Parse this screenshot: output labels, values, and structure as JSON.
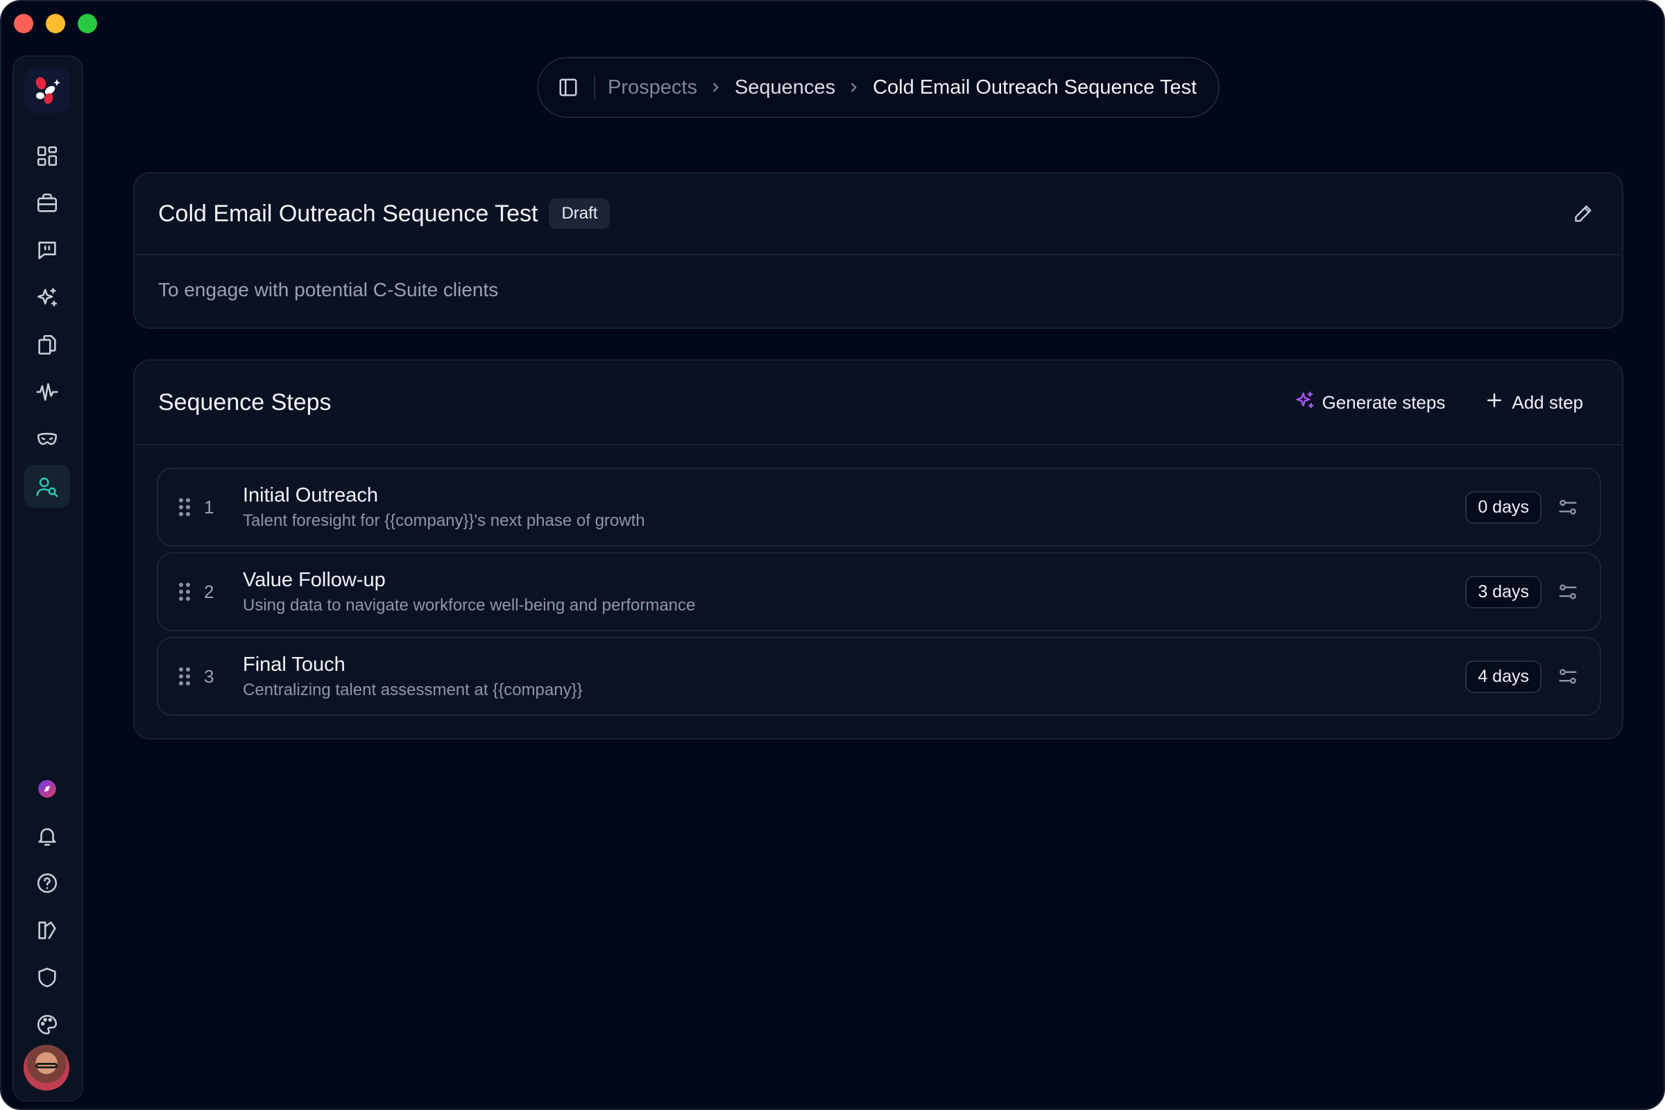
{
  "breadcrumb": {
    "items": [
      "Prospects",
      "Sequences"
    ],
    "current": "Cold Email Outreach Sequence Test"
  },
  "sequence": {
    "title": "Cold Email Outreach Sequence Test",
    "status": "Draft",
    "description": "To engage with potential C-Suite clients"
  },
  "steps_panel": {
    "title": "Sequence Steps",
    "generate_label": "Generate steps",
    "add_label": "Add step"
  },
  "steps": [
    {
      "number": "1",
      "name": "Initial Outreach",
      "subject": "Talent foresight for {{company}}'s next phase of growth",
      "delay": "0 days"
    },
    {
      "number": "2",
      "name": "Value Follow-up",
      "subject": "Using data to navigate workforce well-being and performance",
      "delay": "3 days"
    },
    {
      "number": "3",
      "name": "Final Touch",
      "subject": "Centralizing talent assessment at {{company}}",
      "delay": "4 days"
    }
  ],
  "sidebar": {
    "active": "prospects",
    "top_icons": [
      "dashboard-icon",
      "briefcase-icon",
      "chat-quote-icon",
      "sparkles-icon",
      "documents-icon",
      "waveform-icon",
      "mask-icon",
      "prospects-icon"
    ],
    "bottom_icons": [
      "compass-icon",
      "bell-icon",
      "help-icon",
      "book-icon",
      "shield-icon",
      "palette-icon"
    ]
  },
  "colors": {
    "background": "#03071a",
    "card": "#0a1122",
    "accent_active": "#2fc4b5",
    "generate_accent": "#a855f7"
  }
}
